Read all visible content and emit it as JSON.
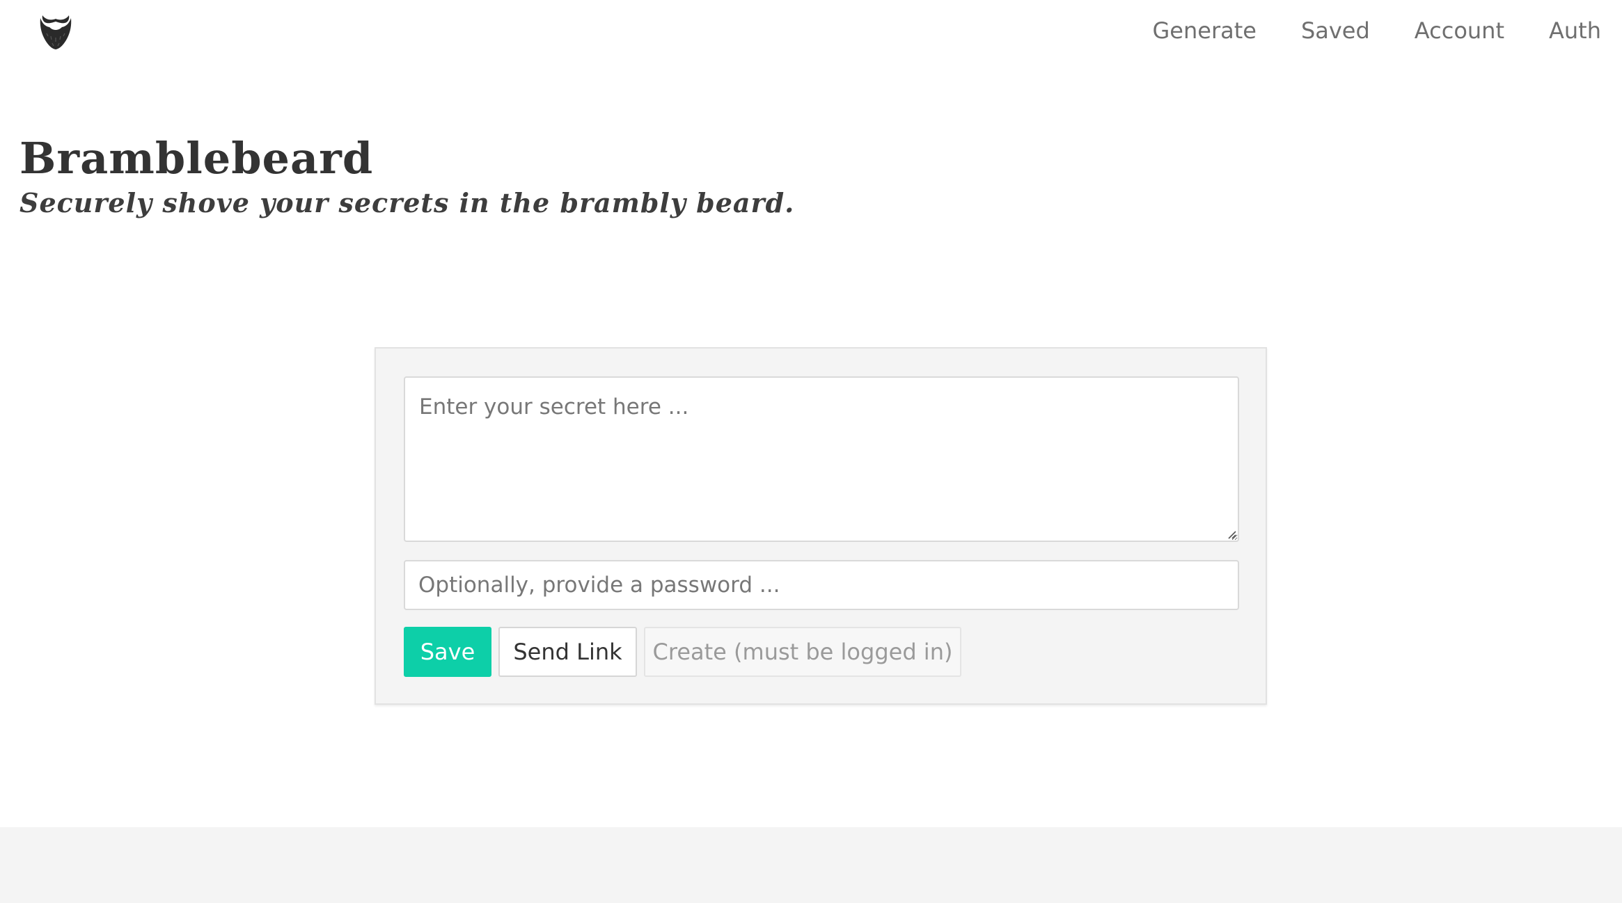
{
  "nav": {
    "logo_icon": "beard-icon",
    "links": [
      {
        "label": "Generate"
      },
      {
        "label": "Saved"
      },
      {
        "label": "Account"
      },
      {
        "label": "Auth"
      }
    ]
  },
  "hero": {
    "title": "Bramblebeard",
    "subtitle": "Securely shove your secrets in the brambly beard."
  },
  "form": {
    "secret_placeholder": "Enter your secret here ...",
    "password_placeholder": "Optionally, provide a password ...",
    "buttons": {
      "save_label": "Save",
      "send_label": "Send Link",
      "create_label": "Create (must be logged in)"
    }
  },
  "colors": {
    "accent": "#0dcfa8",
    "nav_text": "#6f6f6f",
    "heading_text": "#333333",
    "card_background": "#f4f4f4",
    "footer_background": "#f4f4f4"
  }
}
